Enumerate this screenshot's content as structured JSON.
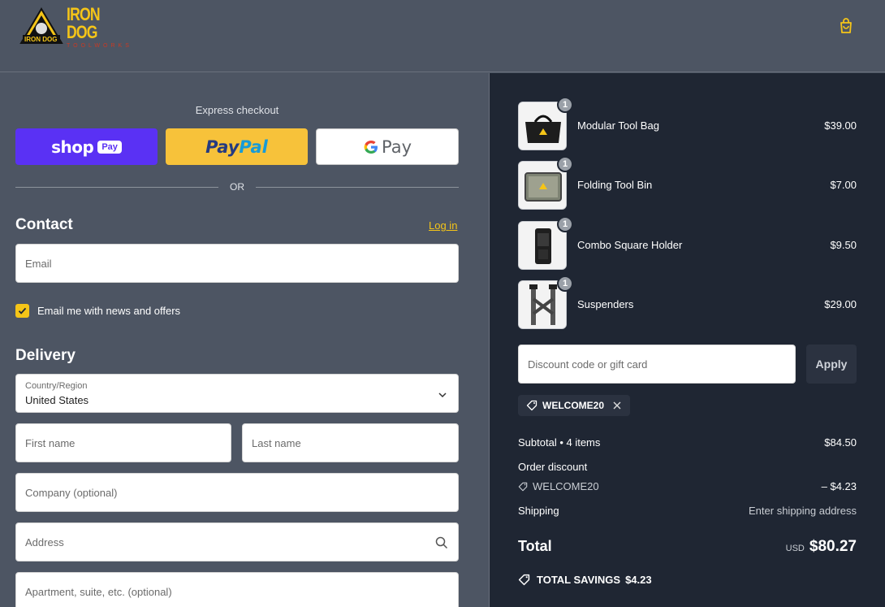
{
  "brand": {
    "title": "IRON DOG",
    "subtitle": "TOOLWORKS",
    "badge": "IRON DOG"
  },
  "express": {
    "label": "Express checkout",
    "shop_label": "shop",
    "shop_badge": "Pay",
    "paypal_a": "Pay",
    "paypal_b": "Pal",
    "gpay_label": "Pay",
    "or_label": "OR"
  },
  "contact": {
    "heading": "Contact",
    "login_label": "Log in",
    "email_placeholder": "Email",
    "newsletter_label": "Email me with news and offers",
    "newsletter_checked": true
  },
  "delivery": {
    "heading": "Delivery",
    "country_label": "Country/Region",
    "country_value": "United States",
    "first_name_placeholder": "First name",
    "last_name_placeholder": "Last name",
    "company_placeholder": "Company (optional)",
    "address_placeholder": "Address",
    "apartment_placeholder": "Apartment, suite, etc. (optional)"
  },
  "cart": {
    "items": [
      {
        "name": "Modular Tool Bag",
        "qty": "1",
        "price": "$39.00"
      },
      {
        "name": "Folding Tool Bin",
        "qty": "1",
        "price": "$7.00"
      },
      {
        "name": "Combo Square Holder",
        "qty": "1",
        "price": "$9.50"
      },
      {
        "name": "Suspenders",
        "qty": "1",
        "price": "$29.00"
      }
    ]
  },
  "discount": {
    "placeholder": "Discount code or gift card",
    "apply_label": "Apply",
    "applied_code": "WELCOME20"
  },
  "summary": {
    "subtotal_label": "Subtotal • 4 items",
    "subtotal_value": "$84.50",
    "order_discount_label": "Order discount",
    "discount_code": "WELCOME20",
    "discount_value": "– $4.23",
    "shipping_label": "Shipping",
    "shipping_value": "Enter shipping address",
    "total_label": "Total",
    "currency": "USD",
    "total_value": "$80.27",
    "savings_label": "TOTAL SAVINGS",
    "savings_value": "$4.23"
  },
  "colors": {
    "accent": "#f5c518",
    "shop": "#5a31f4",
    "paypal": "#f7c23a",
    "panel": "#1f2633",
    "page": "#4d5563"
  }
}
